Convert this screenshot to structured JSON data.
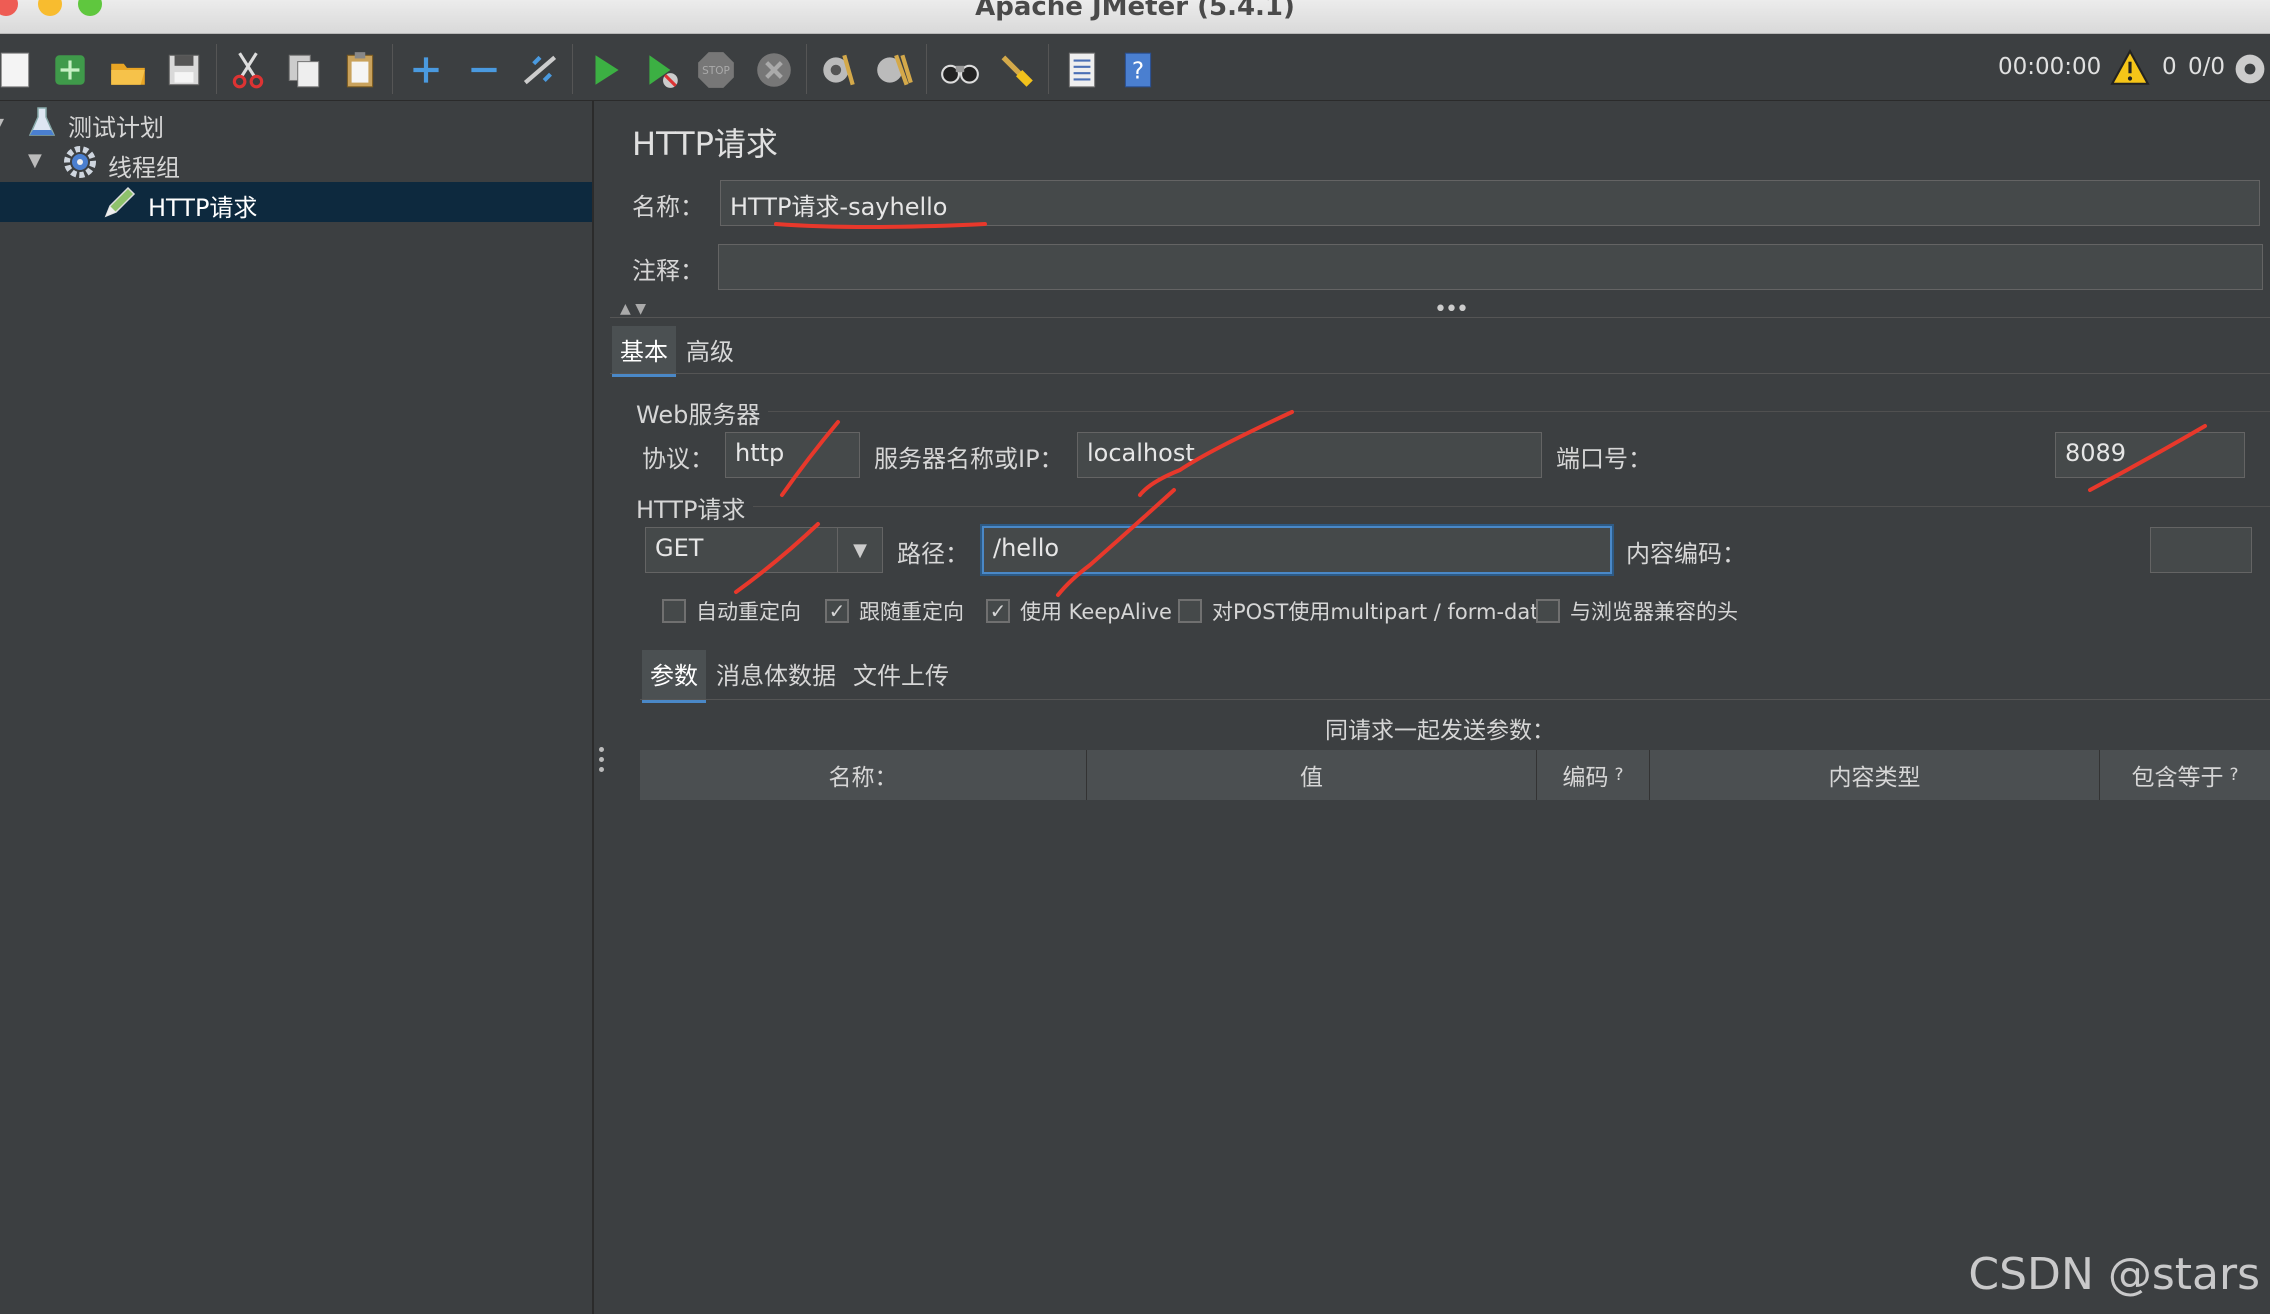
{
  "window": {
    "title": "Apache JMeter (5.4.1)",
    "traffic_lights": {
      "close": "#ee5c54",
      "minimize": "#f8bc2f",
      "zoom": "#5fc73e"
    }
  },
  "toolbar": {
    "timer": "00:00:00",
    "warning_count": "0",
    "threads": "0/0",
    "icons": [
      "new-icon",
      "templates-icon",
      "open-icon",
      "save-icon",
      "cut-icon",
      "copy-icon",
      "paste-icon",
      "expand-icon",
      "collapse-icon",
      "toggle-icon",
      "start-icon",
      "start-no-pause-icon",
      "stop-icon",
      "shutdown-icon",
      "clear-icon",
      "clear-all-icon",
      "search-icon",
      "reset-search-icon",
      "function-helper-icon",
      "help-icon"
    ],
    "stop_label": "STOP"
  },
  "tree": {
    "items": [
      {
        "label": "测试计划",
        "icon": "flask-icon"
      },
      {
        "label": "线程组",
        "icon": "gear-icon"
      },
      {
        "label": "HTTP请求",
        "icon": "pencil-icon"
      }
    ]
  },
  "panel": {
    "title": "HTTP请求",
    "name_label": "名称：",
    "name_value": "HTTP请求-sayhello",
    "comment_label": "注释：",
    "comment_value": "",
    "tabs": [
      "基本",
      "高级"
    ],
    "web_server_legend": "Web服务器",
    "protocol_label": "协议：",
    "protocol_value": "http",
    "server_label": "服务器名称或IP：",
    "server_value": "localhost",
    "port_label": "端口号：",
    "port_value": "8089",
    "http_request_legend": "HTTP请求",
    "method_value": "GET",
    "path_label": "路径：",
    "path_value": "/hello",
    "encoding_label": "内容编码：",
    "encoding_value": "",
    "checkboxes": [
      {
        "label": "自动重定向",
        "checked": false
      },
      {
        "label": "跟随重定向",
        "checked": true
      },
      {
        "label": "使用 KeepAlive",
        "checked": true
      },
      {
        "label": "对POST使用multipart / form-data",
        "checked": false
      },
      {
        "label": "与浏览器兼容的头",
        "checked": false
      }
    ],
    "subtabs": [
      "参数",
      "消息体数据",
      "文件上传"
    ],
    "params_caption": "同请求一起发送参数：",
    "table_headers": [
      {
        "label": "名称：",
        "hint": ""
      },
      {
        "label": "值",
        "hint": ""
      },
      {
        "label": "编码",
        "hint": "?"
      },
      {
        "label": "内容类型",
        "hint": ""
      },
      {
        "label": "包含等于",
        "hint": "?"
      }
    ]
  },
  "watermark": "CSDN @stars",
  "colors": {
    "accent": "#4a88c7",
    "annotation": "#e8382b",
    "background": "#3c3f41",
    "selection": "#0d293e"
  }
}
